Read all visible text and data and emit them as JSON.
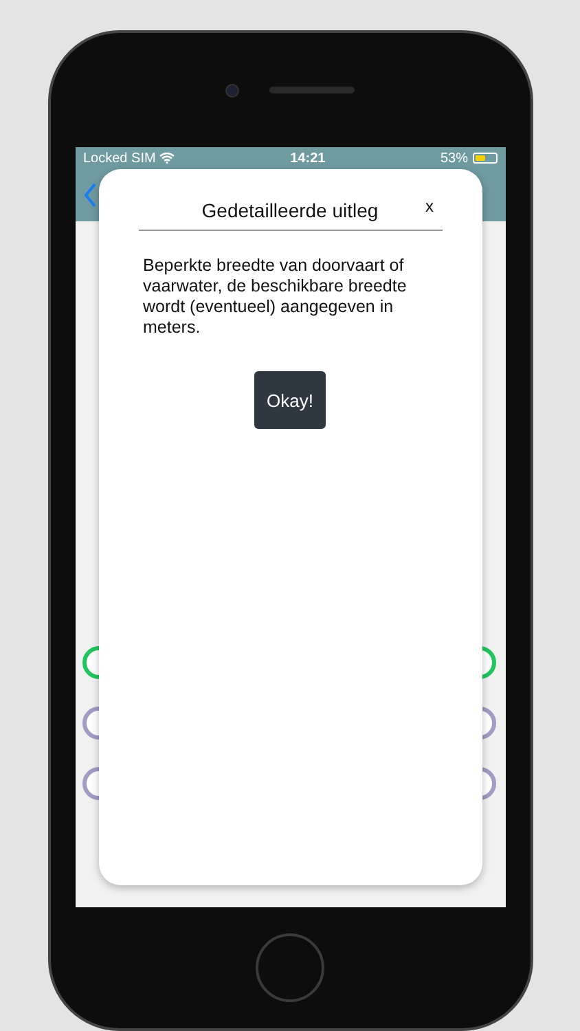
{
  "status_bar": {
    "carrier": "Locked SIM",
    "time": "14:21",
    "battery": "53%"
  },
  "background": {
    "markers": [
      {
        "color": "#22c55e"
      },
      {
        "color": "#a09cc4"
      },
      {
        "color": "#a09cc4"
      }
    ]
  },
  "dialog": {
    "title": "Gedetailleerde uitleg",
    "close": "x",
    "body": "Beperkte breedte van doorvaart of vaarwater, de beschikbare breedte wordt (eventueel) aangegeven in meters.",
    "button": "Okay!"
  }
}
